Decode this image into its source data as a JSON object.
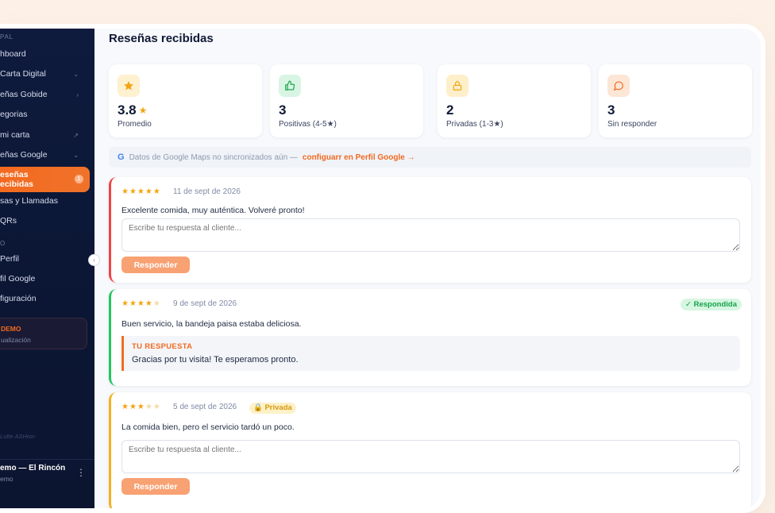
{
  "sidebar": {
    "section_main": "PAL",
    "items": [
      {
        "label": "hboard"
      },
      {
        "label": "Carta Digital"
      },
      {
        "label": "eñas Gobide"
      },
      {
        "label": "egorias"
      },
      {
        "label": " mi carta"
      },
      {
        "label": "eñas Google"
      },
      {
        "label": "eseñas\necibidas",
        "badge": "1"
      },
      {
        "label": "sas y Llamadas"
      },
      {
        "label": " QRs"
      }
    ],
    "section_account": "O",
    "account_items": [
      {
        "label": "Perfil"
      },
      {
        "label": "fil Google"
      },
      {
        "label": "figuración"
      }
    ],
    "demo": {
      "title": "DEMO",
      "subtitle": "ualización"
    },
    "faded_tag": "Lutte ASHion",
    "user": {
      "name": "emo — El Rincón",
      "role": "emo"
    }
  },
  "page": {
    "title": "Reseñas recibidas"
  },
  "stats": [
    {
      "value": "3.8",
      "label": "Promedio",
      "icon": "star-icon",
      "accent": "#f2a411",
      "bg": "#fdf1cf",
      "has_star": true
    },
    {
      "value": "3",
      "label": "Positivas (4-5★)",
      "icon": "thumbs-up-icon",
      "accent": "#16a34a",
      "bg": "#d8f5e3"
    },
    {
      "value": "2",
      "label": "Privadas (1-3★)",
      "icon": "lock-icon",
      "accent": "#f2a411",
      "bg": "#fdefc9"
    },
    {
      "value": "3",
      "label": "Sin responder",
      "icon": "chat-bubble-icon",
      "accent": "#f26a1f",
      "bg": "#fde6d6"
    }
  ],
  "google_notice": {
    "text": "Datos de Google Maps no sincronizados aún —",
    "link": "configuarr en Perfil Google →"
  },
  "reviews": [
    {
      "rating": 5,
      "date": "11 de sept de 2026",
      "text": "Excelente comida, muy auténtica. Volveré pronto!",
      "placeholder": "Escribe tu respuesta al cliente...",
      "button": "Responder"
    },
    {
      "rating": 4,
      "date": "9 de sept de 2026",
      "text": "Buen servicio, la bandeja paisa estaba deliciosa.",
      "status": "✓ Respondida",
      "answer_label": "TU RESPUESTA",
      "answer_text": "Gracias por tu visita! Te esperamos pronto."
    },
    {
      "rating": 3,
      "date": "5 de sept de 2026",
      "private": "🔒 Privada",
      "text": "La comida bien, pero el servicio tardó un poco.",
      "placeholder": "Escribe tu respuesta al cliente...",
      "button": "Responder"
    }
  ],
  "colors": {
    "accent": "#f26a1f",
    "sidebar": "#0f1b3d",
    "star": "#f2a411"
  }
}
